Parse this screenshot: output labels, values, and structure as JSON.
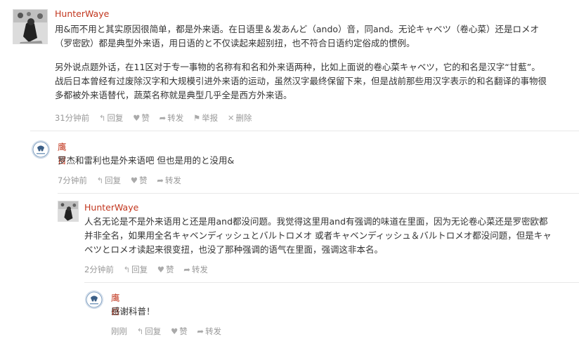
{
  "comments": [
    {
      "author": "HunterWaye",
      "lines": [
        "用&而不用と其实原因很简单，都是外来语。在日语里＆发あんど（ando）音，同and。无论キャベツ（卷心菜）还是ロメオ",
        "（罗密欧）都是典型外来语，用日语的と不仅读起来超别扭，也不符合日语约定俗成的惯例。",
        "另外说点题外话，在11区对于专一事物的名称有和名和外来语两种，比如上面说的卷心菜キャベツ，它的和名是汉字“甘藍”。",
        "战后日本曾经有过废除汉字和大规模引进外来语的运动，虽然汉字最终保留下来，但是战前那些用汉字表示的和名翻译的事物很",
        "多都被外来语替代，蔬菜名称就是典型几乎全是西方外来语。"
      ],
      "time": "31分钟前",
      "actions": [
        "回复",
        "赞",
        "转发",
        "举报",
        "删除"
      ]
    },
    {
      "author": "鹰目",
      "lines": [
        "罗杰和雷利也是外来语吧 但也是用的と没用&"
      ],
      "time": "7分钟前",
      "actions": [
        "回复",
        "赞",
        "转发"
      ]
    },
    {
      "author": "HunterWaye",
      "lines": [
        "人名无论是不是外来语用と还是用and都没问题。我觉得这里用and有强调的味道在里面，因为无论卷心菜还是罗密欧都",
        "并非全名，如果用全名キャベンディッシュとバルトロメオ 或者キャベンディッシュ＆バルトロメオ都没问题，但是キャ",
        "ベツとロメオ读起来很变扭，也没了那种强调的语气在里面，强调这非本名。"
      ],
      "time": "2分钟前",
      "actions": [
        "回复",
        "赞",
        "转发"
      ]
    },
    {
      "author": "鹰目",
      "lines": [
        "感谢科普！"
      ],
      "time": "刚刚",
      "actions": [
        "回复",
        "赞",
        "转发"
      ]
    }
  ],
  "icons": {
    "reply": "reply-arrow-icon",
    "like": "heart-icon",
    "share": "share-arrow-icon",
    "report": "flag-icon",
    "delete": "x-icon"
  },
  "colors": {
    "author": "#c2361e",
    "meta": "#999999",
    "divider": "#e8e8e8"
  }
}
